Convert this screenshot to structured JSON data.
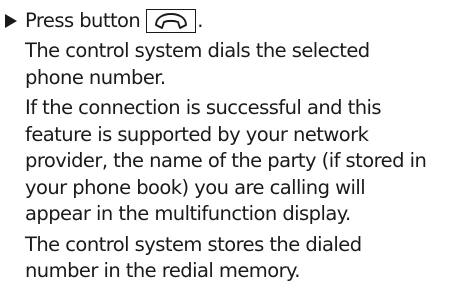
{
  "step": {
    "text": "Press button",
    "end": "."
  },
  "paragraphs": [
    {
      "lines": [
        "The control system dials the selected",
        "phone number."
      ]
    },
    {
      "lines": [
        "If the connection is successful and this",
        "feature is supported by your network",
        "provider, the name of the party (if stored in",
        "your phone book) you are calling will",
        "appear in the multifunction display."
      ]
    },
    {
      "lines": [
        "The control system stores the dialed",
        "number in the redial memory."
      ]
    }
  ]
}
